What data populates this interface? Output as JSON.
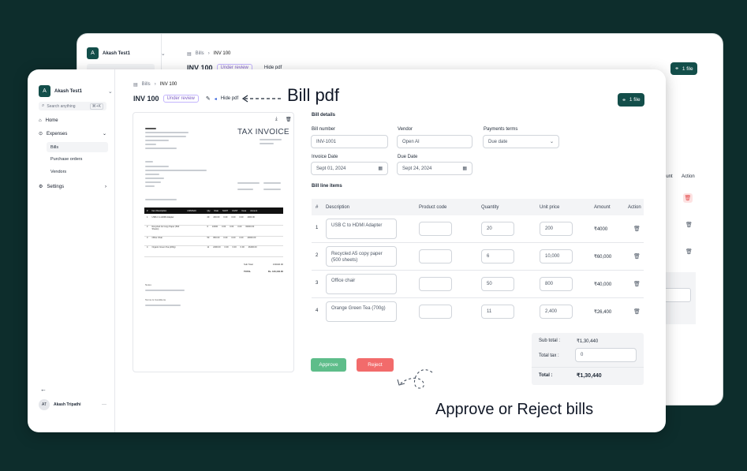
{
  "back_window": {
    "workspace": "Akash Test1",
    "workspace_initial": "A",
    "breadcrumb_bills": "Bills",
    "breadcrumb_invoice": "INV 100",
    "title": "INV 100",
    "status": "Under review",
    "hide_pdf": "Hide pdf",
    "file_button": "1 file",
    "col_amount": "ount",
    "col_action": "Action"
  },
  "sidebar": {
    "workspace": "Akash Test1",
    "workspace_initial": "A",
    "search_placeholder": "Search anything",
    "search_shortcut": "⌘+K",
    "home": "Home",
    "expenses": "Expenses",
    "bills": "Bills",
    "purchase_orders": "Purchase orders",
    "vendors": "Vendors",
    "settings": "Settings",
    "user_initials": "AT",
    "user_name": "Akash Tripathi",
    "user_menu": "···"
  },
  "header": {
    "breadcrumb_bills": "Bills",
    "breadcrumb_invoice": "INV 100",
    "title": "INV 100",
    "status": "Under review",
    "hide_pdf": "Hide pdf",
    "file_button": "1 file"
  },
  "pdf": {
    "title": "TAX INVOICE",
    "headers": [
      "#",
      "Item Description",
      "HSN/SAC",
      "Qty",
      "Rate",
      "SGST",
      "CGST",
      "Cess",
      "Amount"
    ],
    "rows": [
      [
        "1",
        "USB-C to HDMI Adapter",
        "",
        "20",
        "200.00",
        "0.00",
        "0.00",
        "0.00",
        "4000.00"
      ],
      [
        "2",
        "Recycled A4 Copy Paper (500 Sheets)",
        "",
        "6",
        "10000",
        "0.00",
        "0.00",
        "0.00",
        "60000.00"
      ],
      [
        "3",
        "Office Chair",
        "",
        "50",
        "800.00",
        "0.00",
        "0.00",
        "0.00",
        "40000.00"
      ],
      [
        "4",
        "Organic Green Tea (200g)",
        "",
        "11",
        "2400.00",
        "0.00",
        "0.00",
        "0.00",
        "26400.00"
      ]
    ],
    "sub_total_label": "Sub Total",
    "sub_total": "130440.00",
    "total_label": "TOTAL",
    "total": "Rs. 130,440.00",
    "notes_label": "Notes",
    "terms_label": "Terms & Conditions"
  },
  "bill_details": {
    "section": "Bill details",
    "bill_number_label": "Bill number",
    "bill_number": "INV-1001",
    "vendor_label": "Vendor",
    "vendor": "Open AI",
    "payment_terms_label": "Payments terms",
    "payment_terms": "Due date",
    "invoice_date_label": "Invoice Date",
    "invoice_date": "Sept 01, 2024",
    "due_date_label": "Due Date",
    "due_date": "Sept 24, 2024"
  },
  "line_items": {
    "section": "Bill line items",
    "columns": [
      "#",
      "Description",
      "Product code",
      "Quantity",
      "Unit price",
      "Amount",
      "Action"
    ],
    "rows": [
      {
        "n": "1",
        "description": "USB C to HDMI Adapter",
        "quantity": "20",
        "unit_price": "200",
        "amount": "₹4000"
      },
      {
        "n": "2",
        "description": "Recycled A5 copy paper (500 sheets)",
        "quantity": "6",
        "unit_price": "10,000",
        "amount": "₹60,000"
      },
      {
        "n": "3",
        "description": "Office chair",
        "quantity": "50",
        "unit_price": "800",
        "amount": "₹40,000"
      },
      {
        "n": "4",
        "description": "Orange Green Tea (700g)",
        "quantity": "11",
        "unit_price": "2,400",
        "amount": "₹26,400"
      }
    ]
  },
  "totals": {
    "sub_total_label": "Sub total :",
    "sub_total": "₹1,30,440",
    "total_tax_label": "Total tax :",
    "total_tax": "0",
    "total_label": "Total :",
    "total": "₹1,30,440"
  },
  "actions": {
    "approve": "Approve",
    "reject": "Reject"
  },
  "annotations": {
    "bill_pdf": "Bill pdf",
    "approve_reject": "Approve or Reject bills"
  },
  "colors": {
    "brand": "#134e4a",
    "approve": "#5ebd8a",
    "reject": "#f26b6b",
    "status": "#7c5cc4",
    "background": "#0d2d2c"
  }
}
